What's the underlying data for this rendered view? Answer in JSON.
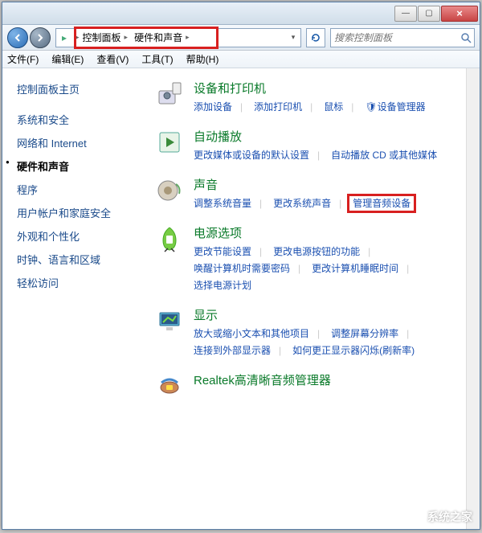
{
  "titlebar": {
    "min": "—",
    "max": "▢",
    "close": "×"
  },
  "nav": {
    "crumb1": "控制面板",
    "crumb2": "硬件和声音",
    "searchPlaceholder": "搜索控制面板"
  },
  "menu": [
    "文件(F)",
    "编辑(E)",
    "查看(V)",
    "工具(T)",
    "帮助(H)"
  ],
  "sidebar": {
    "title": "控制面板主页",
    "items": [
      {
        "label": "系统和安全",
        "active": false
      },
      {
        "label": "网络和 Internet",
        "active": false
      },
      {
        "label": "硬件和声音",
        "active": true
      },
      {
        "label": "程序",
        "active": false
      },
      {
        "label": "用户帐户和家庭安全",
        "active": false
      },
      {
        "label": "外观和个性化",
        "active": false
      },
      {
        "label": "时钟、语言和区域",
        "active": false
      },
      {
        "label": "轻松访问",
        "active": false
      }
    ]
  },
  "cats": [
    {
      "title": "设备和打印机",
      "links": [
        "添加设备",
        "添加打印机",
        "鼠标",
        "🛡设备管理器"
      ]
    },
    {
      "title": "自动播放",
      "links": [
        "更改媒体或设备的默认设置",
        "自动播放 CD 或其他媒体"
      ]
    },
    {
      "title": "声音",
      "links": [
        "调整系统音量",
        "更改系统声音",
        "管理音频设备"
      ],
      "highlight": 2
    },
    {
      "title": "电源选项",
      "links": [
        "更改节能设置",
        "更改电源按钮的功能",
        "唤醒计算机时需要密码",
        "更改计算机睡眠时间",
        "选择电源计划"
      ]
    },
    {
      "title": "显示",
      "links": [
        "放大或缩小文本和其他项目",
        "调整屏幕分辨率",
        "连接到外部显示器",
        "如何更正显示器闪烁(刷新率)"
      ]
    },
    {
      "title": "Realtek高清晰音频管理器",
      "links": []
    }
  ],
  "watermark": "系统之家"
}
